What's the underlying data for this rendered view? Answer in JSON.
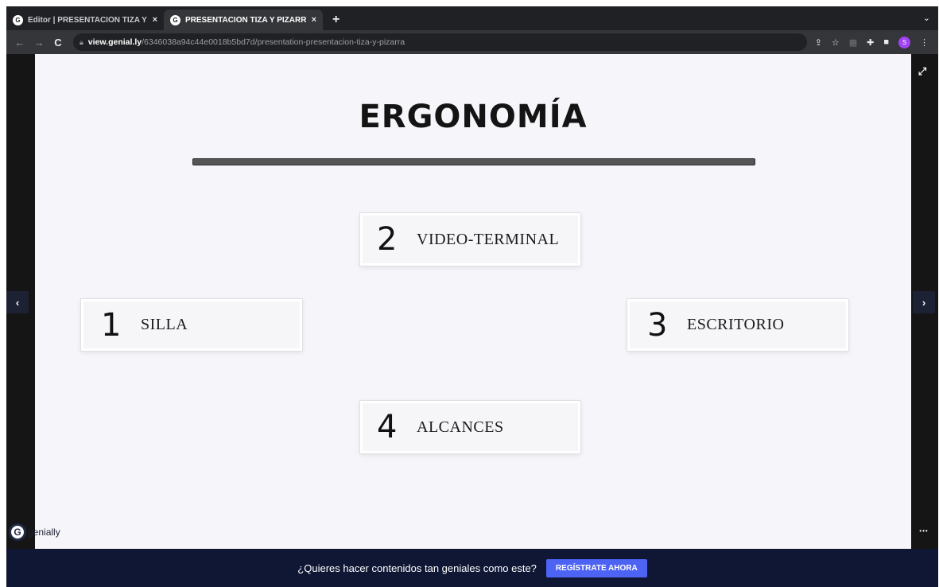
{
  "browser": {
    "tabs": [
      {
        "title": "Editor | PRESENTACIÓN TIZA Y",
        "close": "×",
        "active": false
      },
      {
        "title": "PRESENTACIÓN TIZA Y PIZARR",
        "close": "×",
        "active": true
      }
    ],
    "new_tab": "+",
    "tab_menu": "⌄",
    "url_host": "view.genial.ly",
    "url_path": "/6346038a94c44e0018b5bd7d/presentation-presentacion-tiza-y-pizarra",
    "profile_initial": "S"
  },
  "slide": {
    "title": "ERGONOMÍA",
    "cards": [
      {
        "number": "1",
        "label": "SILLA"
      },
      {
        "number": "2",
        "label": "VIDEO-TERMINAL"
      },
      {
        "number": "3",
        "label": "ESCRITORIO"
      },
      {
        "number": "4",
        "label": "ALCANCES"
      }
    ]
  },
  "viewer": {
    "prev": "‹",
    "next": "›",
    "more": "•••",
    "logo_text": "genially",
    "logo_mark": "G"
  },
  "banner": {
    "message": "¿Quieres hacer contenidos tan geniales como este?",
    "cta": "REGÍSTRATE AHORA"
  },
  "colors": {
    "banner": "#0f1735",
    "cta": "#4d63f3",
    "slide_bg": "#f6f5fa"
  }
}
